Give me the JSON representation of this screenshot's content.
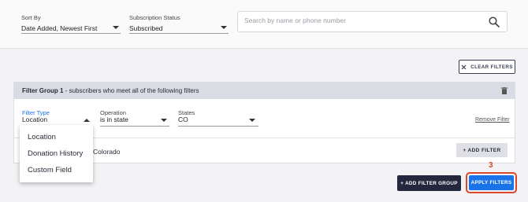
{
  "sort": {
    "label": "Sort By",
    "value": "Date Added, Newest First"
  },
  "subscription": {
    "label": "Subscription Status",
    "value": "Subscribed"
  },
  "search": {
    "placeholder": "Search by name or phone number"
  },
  "clear_filters": {
    "label": "CLEAR FILTERS"
  },
  "filter_group": {
    "title_bold": "Filter Group 1",
    "title_rest": " - subscribers who meet all of the following filters",
    "filter_type": {
      "label": "Filter Type",
      "value": "Location"
    },
    "operation": {
      "label": "Operation",
      "value": "is in state"
    },
    "states": {
      "label": "States",
      "value": "CO"
    },
    "remove_label": "Remove Filter",
    "summary": "Colorado",
    "add_filter_label": "+ ADD FILTER"
  },
  "dropdown": {
    "options": [
      "Location",
      "Donation History",
      "Custom Field"
    ]
  },
  "add_filter_group": {
    "label": "+ ADD FILTER GROUP"
  },
  "apply_filters": {
    "label": "APPLY FILTERS"
  },
  "step_marker": "3",
  "colors": {
    "accent_blue": "#1a73e8",
    "navy": "#23283f",
    "highlight": "#d9482b"
  }
}
